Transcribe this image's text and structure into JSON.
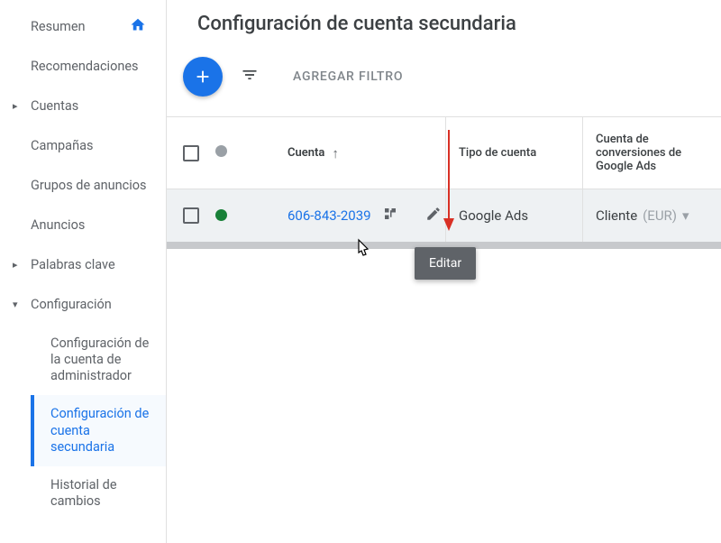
{
  "pageTitle": "Configuración de cuenta secundaria",
  "sidebar": {
    "items": [
      {
        "label": "Resumen",
        "hasHome": true
      },
      {
        "label": "Recomendaciones"
      },
      {
        "label": "Cuentas",
        "expandable": true
      },
      {
        "label": "Campañas"
      },
      {
        "label": "Grupos de anuncios"
      },
      {
        "label": "Anuncios"
      },
      {
        "label": "Palabras clave",
        "expandable": true
      },
      {
        "label": "Configuración",
        "expandable": true,
        "expanded": true,
        "children": [
          {
            "label": "Configuración de la cuenta de administrador"
          },
          {
            "label": "Configuración de cuenta secundaria",
            "active": true
          },
          {
            "label": "Historial de cambios"
          }
        ]
      }
    ]
  },
  "toolbar": {
    "addFilterLabel": "AGREGAR FILTRO"
  },
  "table": {
    "headers": {
      "account": "Cuenta",
      "accountType": "Tipo de cuenta",
      "conversionAccount": "Cuenta de conversiones de Google Ads"
    },
    "rows": [
      {
        "accountId": "606-843-2039",
        "statusColor": "green",
        "accountType": "Google Ads",
        "clientLabel": "Cliente",
        "currency": "(EUR)"
      }
    ]
  },
  "tooltip": "Editar"
}
